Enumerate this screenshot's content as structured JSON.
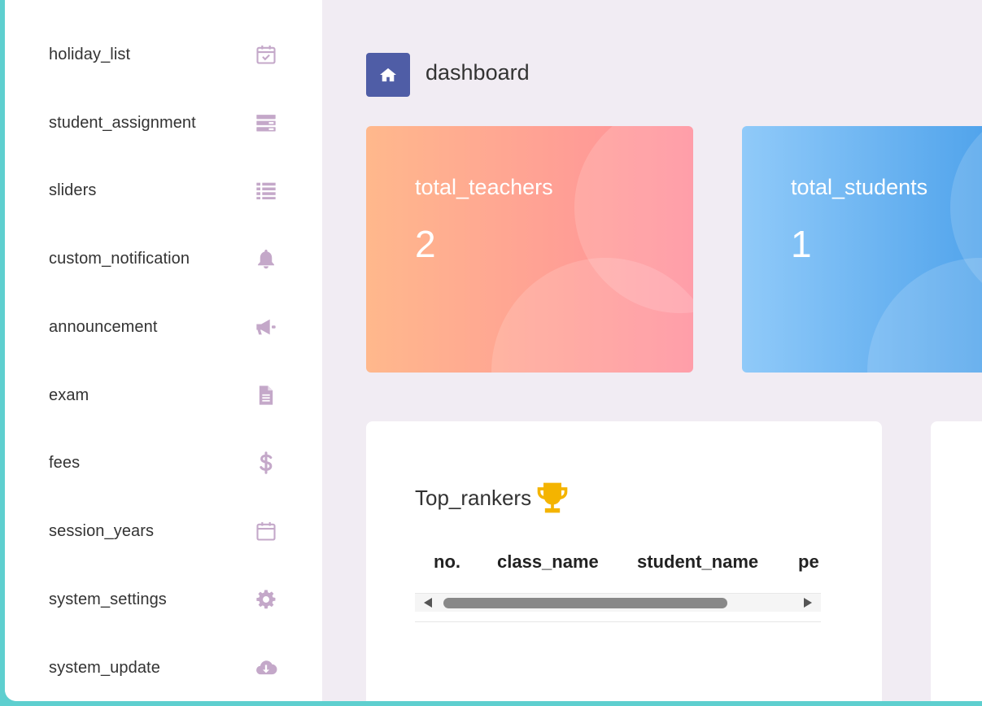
{
  "sidebar": {
    "items": [
      {
        "label": "holiday_list",
        "icon": "calendar-check-icon"
      },
      {
        "label": "student_assignment",
        "icon": "assignment-list-icon"
      },
      {
        "label": "sliders",
        "icon": "list-icon"
      },
      {
        "label": "custom_notification",
        "icon": "bell-icon"
      },
      {
        "label": "announcement",
        "icon": "megaphone-icon"
      },
      {
        "label": "exam",
        "icon": "file-text-icon"
      },
      {
        "label": "fees",
        "icon": "dollar-icon"
      },
      {
        "label": "session_years",
        "icon": "calendar-icon"
      },
      {
        "label": "system_settings",
        "icon": "gear-icon"
      },
      {
        "label": "system_update",
        "icon": "cloud-download-icon"
      }
    ],
    "icon_color": "#c4a8c9"
  },
  "header": {
    "title": "dashboard",
    "home_icon": "home-icon",
    "accent": "#4f5da6"
  },
  "stats": [
    {
      "label": "total_teachers",
      "value": "2"
    },
    {
      "label": "total_students",
      "value": "1"
    }
  ],
  "top_rankers": {
    "title": "Top_rankers",
    "trophy_icon": "trophy-icon",
    "columns": [
      "no.",
      "class_name",
      "student_name",
      "pe"
    ]
  }
}
